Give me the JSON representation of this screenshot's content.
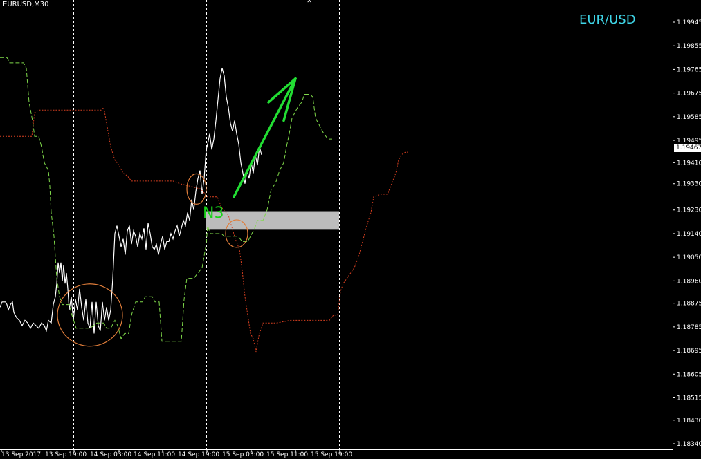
{
  "header": {
    "symbol_label": "EURUSD,M30",
    "pair_title": "EUR/USD",
    "zone_label": "N3",
    "current_price_label": "1.19467"
  },
  "colors": {
    "background": "#000000",
    "price_line": "#ffffff",
    "green_dashed": "#7fd94a",
    "red_dotted": "#d94020",
    "arrow": "#22dd33",
    "circle": "#e07d3a",
    "zone": "#bcbcbc",
    "title": "#3fd6e8"
  },
  "chart_data": {
    "type": "line",
    "title": "EUR/USD",
    "xlabel": "",
    "ylabel": "",
    "ylim": [
      1.1829,
      1.1999
    ],
    "x_tick_labels": [
      "13 Sep 2017",
      "13 Sep 19:00",
      "14 Sep 03:00",
      "14 Sep 11:00",
      "14 Sep 19:00",
      "15 Sep 03:00",
      "15 Sep 11:00",
      "15 Sep 19:00"
    ],
    "y_tick_labels": [
      "1.19945",
      "1.19855",
      "1.19765",
      "1.19675",
      "1.19585",
      "1.19495",
      "1.19410",
      "1.19330",
      "1.19230",
      "1.19140",
      "1.19050",
      "1.18960",
      "1.18875",
      "1.18785",
      "1.18695",
      "1.18605",
      "1.18515",
      "1.18430",
      "1.18340"
    ],
    "current_price": 1.19467,
    "grid": false,
    "session_separators": [
      "13 Sep 19:00",
      "14 Sep 19:00",
      "15 Sep 19:00"
    ],
    "series": [
      {
        "name": "",
        "style": "solid-white",
        "points": [
          [
            0,
            1.1886
          ],
          [
            3,
            1.1888
          ],
          [
            8,
            1.1888
          ],
          [
            10,
            1.1887
          ],
          [
            12,
            1.1885
          ],
          [
            15,
            1.1887
          ],
          [
            18,
            1.1888
          ],
          [
            20,
            1.1884
          ],
          [
            24,
            1.1882
          ],
          [
            28,
            1.1881
          ],
          [
            32,
            1.1879
          ],
          [
            36,
            1.1881
          ],
          [
            40,
            1.188
          ],
          [
            44,
            1.1878
          ],
          [
            48,
            1.188
          ],
          [
            52,
            1.1879
          ],
          [
            56,
            1.1878
          ],
          [
            60,
            1.188
          ],
          [
            64,
            1.1879
          ],
          [
            67,
            1.1877
          ],
          [
            70,
            1.1881
          ],
          [
            74,
            1.188
          ],
          [
            77,
            1.1887
          ],
          [
            80,
            1.189
          ],
          [
            82,
            1.1895
          ],
          [
            84,
            1.1903
          ],
          [
            86,
            1.1899
          ],
          [
            88,
            1.1903
          ],
          [
            90,
            1.1896
          ],
          [
            92,
            1.1902
          ],
          [
            94,
            1.1895
          ],
          [
            96,
            1.1899
          ],
          [
            98,
            1.1893
          ],
          [
            100,
            1.1885
          ],
          [
            103,
            1.189
          ],
          [
            106,
            1.1881
          ],
          [
            109,
            1.1889
          ],
          [
            112,
            1.1885
          ],
          [
            115,
            1.1893
          ],
          [
            118,
            1.1886
          ],
          [
            121,
            1.1881
          ],
          [
            124,
            1.1889
          ],
          [
            127,
            1.188
          ],
          [
            130,
            1.1878
          ],
          [
            133,
            1.1888
          ],
          [
            136,
            1.1876
          ],
          [
            139,
            1.1888
          ],
          [
            142,
            1.1879
          ],
          [
            145,
            1.1877
          ],
          [
            148,
            1.1888
          ],
          [
            151,
            1.1881
          ],
          [
            154,
            1.1886
          ],
          [
            157,
            1.1881
          ],
          [
            160,
            1.1885
          ],
          [
            163,
            1.1897
          ],
          [
            166,
            1.1914
          ],
          [
            169,
            1.1917
          ],
          [
            172,
            1.1913
          ],
          [
            175,
            1.1909
          ],
          [
            178,
            1.1912
          ],
          [
            181,
            1.1906
          ],
          [
            184,
            1.1915
          ],
          [
            187,
            1.1917
          ],
          [
            190,
            1.191
          ],
          [
            193,
            1.1915
          ],
          [
            196,
            1.1913
          ],
          [
            199,
            1.1909
          ],
          [
            202,
            1.1914
          ],
          [
            205,
            1.1912
          ],
          [
            208,
            1.1916
          ],
          [
            211,
            1.1908
          ],
          [
            214,
            1.1918
          ],
          [
            217,
            1.1914
          ],
          [
            220,
            1.1909
          ],
          [
            223,
            1.1908
          ],
          [
            226,
            1.191
          ],
          [
            229,
            1.1906
          ],
          [
            232,
            1.191
          ],
          [
            235,
            1.1913
          ],
          [
            238,
            1.1908
          ],
          [
            241,
            1.1911
          ],
          [
            244,
            1.1911
          ],
          [
            247,
            1.1914
          ],
          [
            250,
            1.1912
          ],
          [
            253,
            1.1915
          ],
          [
            256,
            1.1917
          ],
          [
            259,
            1.1913
          ],
          [
            262,
            1.1916
          ],
          [
            265,
            1.1919
          ],
          [
            268,
            1.1917
          ],
          [
            271,
            1.1922
          ],
          [
            274,
            1.1919
          ],
          [
            277,
            1.1927
          ],
          [
            280,
            1.1923
          ],
          [
            283,
            1.193
          ],
          [
            286,
            1.1935
          ],
          [
            289,
            1.1938
          ],
          [
            292,
            1.1929
          ],
          [
            295,
            1.1935
          ],
          [
            298,
            1.1946
          ],
          [
            300,
            1.1948
          ],
          [
            303,
            1.1952
          ],
          [
            306,
            1.1946
          ],
          [
            309,
            1.195
          ],
          [
            312,
            1.1957
          ],
          [
            315,
            1.1965
          ],
          [
            318,
            1.1973
          ],
          [
            321,
            1.1977
          ],
          [
            324,
            1.1974
          ],
          [
            327,
            1.1966
          ],
          [
            330,
            1.1962
          ],
          [
            333,
            1.1956
          ],
          [
            336,
            1.1953
          ],
          [
            339,
            1.1957
          ],
          [
            342,
            1.1952
          ],
          [
            345,
            1.1948
          ],
          [
            348,
            1.1941
          ],
          [
            351,
            1.1937
          ],
          [
            354,
            1.1933
          ],
          [
            357,
            1.1938
          ],
          [
            360,
            1.1935
          ],
          [
            363,
            1.1941
          ],
          [
            366,
            1.1937
          ],
          [
            369,
            1.1944
          ],
          [
            372,
            1.194
          ],
          [
            375,
            1.1947
          ],
          [
            378,
            1.1944
          ]
        ]
      },
      {
        "name": "",
        "style": "dashed-green",
        "points": [
          [
            0,
            1.1981
          ],
          [
            10,
            1.1981
          ],
          [
            14,
            1.1979
          ],
          [
            34,
            1.1979
          ],
          [
            38,
            1.1977
          ],
          [
            42,
            1.1964
          ],
          [
            47,
            1.1957
          ],
          [
            50,
            1.1951
          ],
          [
            56,
            1.1951
          ],
          [
            60,
            1.1947
          ],
          [
            64,
            1.1941
          ],
          [
            70,
            1.1938
          ],
          [
            72,
            1.1932
          ],
          [
            74,
            1.1922
          ],
          [
            78,
            1.1913
          ],
          [
            82,
            1.1897
          ],
          [
            86,
            1.189
          ],
          [
            90,
            1.1887
          ],
          [
            100,
            1.1887
          ],
          [
            104,
            1.1883
          ],
          [
            110,
            1.1878
          ],
          [
            130,
            1.1878
          ],
          [
            140,
            1.188
          ],
          [
            150,
            1.188
          ],
          [
            154,
            1.1878
          ],
          [
            160,
            1.1878
          ],
          [
            166,
            1.1881
          ],
          [
            170,
            1.1879
          ],
          [
            175,
            1.1874
          ],
          [
            180,
            1.1876
          ],
          [
            186,
            1.1876
          ],
          [
            190,
            1.1883
          ],
          [
            196,
            1.1888
          ],
          [
            206,
            1.1888
          ],
          [
            210,
            1.189
          ],
          [
            220,
            1.189
          ],
          [
            224,
            1.1888
          ],
          [
            230,
            1.1888
          ],
          [
            234,
            1.1873
          ],
          [
            262,
            1.1873
          ],
          [
            266,
            1.1889
          ],
          [
            270,
            1.1897
          ],
          [
            280,
            1.1897
          ],
          [
            286,
            1.1899
          ],
          [
            292,
            1.1901
          ],
          [
            298,
            1.191
          ],
          [
            300,
            1.1917
          ],
          [
            304,
            1.1914
          ],
          [
            310,
            1.1914
          ],
          [
            320,
            1.1914
          ],
          [
            324,
            1.1913
          ],
          [
            334,
            1.1913
          ],
          [
            344,
            1.1913
          ],
          [
            350,
            1.1911
          ],
          [
            358,
            1.1911
          ],
          [
            362,
            1.1913
          ],
          [
            368,
            1.1916
          ],
          [
            372,
            1.1919
          ],
          [
            380,
            1.1919
          ],
          [
            386,
            1.1923
          ],
          [
            392,
            1.1931
          ],
          [
            398,
            1.1933
          ],
          [
            404,
            1.1938
          ],
          [
            410,
            1.1941
          ],
          [
            414,
            1.1947
          ],
          [
            418,
            1.1952
          ],
          [
            422,
            1.1958
          ],
          [
            426,
            1.196
          ],
          [
            430,
            1.1962
          ],
          [
            436,
            1.1964
          ],
          [
            440,
            1.1967
          ],
          [
            448,
            1.1967
          ],
          [
            452,
            1.1966
          ],
          [
            456,
            1.1958
          ],
          [
            462,
            1.1955
          ],
          [
            468,
            1.1952
          ],
          [
            474,
            1.195
          ],
          [
            480,
            1.195
          ]
        ]
      },
      {
        "name": "",
        "style": "dotted-red",
        "points": [
          [
            0,
            1.1951
          ],
          [
            46,
            1.1951
          ],
          [
            50,
            1.196
          ],
          [
            56,
            1.1961
          ],
          [
            100,
            1.1961
          ],
          [
            146,
            1.1961
          ],
          [
            150,
            1.1962
          ],
          [
            154,
            1.1956
          ],
          [
            160,
            1.1947
          ],
          [
            166,
            1.1942
          ],
          [
            172,
            1.194
          ],
          [
            178,
            1.1937
          ],
          [
            184,
            1.1936
          ],
          [
            190,
            1.1934
          ],
          [
            200,
            1.1934
          ],
          [
            220,
            1.1934
          ],
          [
            250,
            1.1934
          ],
          [
            260,
            1.1933
          ],
          [
            290,
            1.1931
          ],
          [
            300,
            1.1928
          ],
          [
            306,
            1.1928
          ],
          [
            314,
            1.1928
          ],
          [
            320,
            1.1924
          ],
          [
            330,
            1.1921
          ],
          [
            340,
            1.1912
          ],
          [
            346,
            1.1908
          ],
          [
            350,
            1.19
          ],
          [
            354,
            1.189
          ],
          [
            358,
            1.1883
          ],
          [
            362,
            1.1876
          ],
          [
            366,
            1.1874
          ],
          [
            370,
            1.1869
          ],
          [
            374,
            1.1875
          ],
          [
            380,
            1.188
          ],
          [
            400,
            1.188
          ],
          [
            420,
            1.1881
          ],
          [
            450,
            1.1881
          ],
          [
            476,
            1.1881
          ],
          [
            482,
            1.1883
          ],
          [
            488,
            1.1883
          ],
          [
            492,
            1.1892
          ],
          [
            496,
            1.1895
          ],
          [
            504,
            1.1898
          ],
          [
            512,
            1.1901
          ],
          [
            518,
            1.1905
          ],
          [
            522,
            1.1909
          ],
          [
            526,
            1.1913
          ],
          [
            530,
            1.1917
          ],
          [
            536,
            1.1922
          ],
          [
            540,
            1.1928
          ],
          [
            550,
            1.1929
          ],
          [
            560,
            1.1929
          ],
          [
            566,
            1.1933
          ],
          [
            572,
            1.1937
          ],
          [
            576,
            1.1942
          ],
          [
            580,
            1.1944
          ],
          [
            586,
            1.1945
          ],
          [
            590,
            1.1945
          ]
        ]
      }
    ],
    "arrows": [
      {
        "from": [
          338,
          1.1928
        ],
        "to": [
          427,
          1.1973
        ]
      },
      {
        "from": [
          388,
          1.1964
        ],
        "to": [
          427,
          1.1973
        ]
      },
      {
        "from": [
          410,
          1.1957
        ],
        "to": [
          427,
          1.1973
        ]
      }
    ],
    "circles": [
      {
        "cx": 130,
        "cy": 1.1883,
        "rx": 47,
        "ry": 45
      },
      {
        "cx": 284,
        "cy": 1.1931,
        "rx": 14,
        "ry": 22
      },
      {
        "cx": 342,
        "cy": 1.1914,
        "rx": 16,
        "ry": 20
      }
    ],
    "zone": {
      "x_start": 298,
      "x_end": 490,
      "y_low": 1.1916,
      "y_high": 1.1922
    }
  }
}
